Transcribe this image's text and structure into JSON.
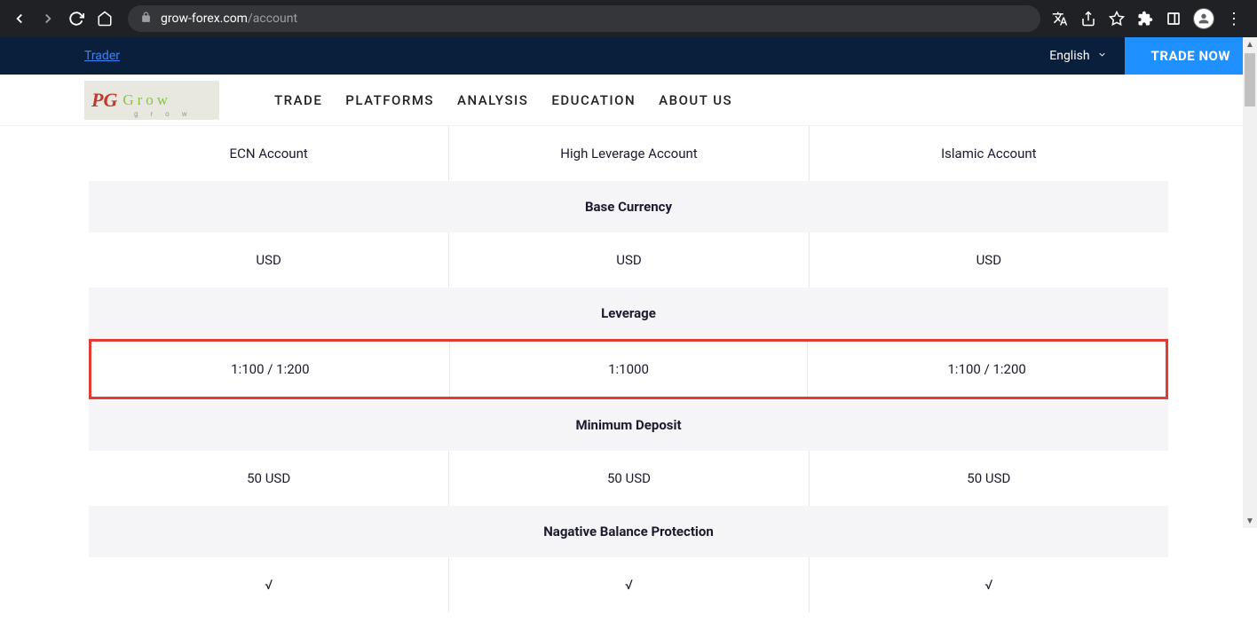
{
  "browser": {
    "url_host": "grow-forex.com",
    "url_path": "/account"
  },
  "topbar": {
    "trader": "Trader",
    "language": "English",
    "trade_now": "TRADE NOW"
  },
  "nav": {
    "items": [
      "TRADE",
      "PLATFORMS",
      "ANALYSIS",
      "EDUCATION",
      "ABOUT US"
    ]
  },
  "table": {
    "account_types": [
      "ECN Account",
      "High Leverage Account",
      "Islamic Account"
    ],
    "sections": {
      "base_currency": {
        "label": "Base Currency",
        "values": [
          "USD",
          "USD",
          "USD"
        ]
      },
      "leverage": {
        "label": "Leverage",
        "values": [
          "1:100 / 1:200",
          "1:1000",
          "1:100 / 1:200"
        ],
        "highlighted": true
      },
      "min_deposit": {
        "label": "Minimum Deposit",
        "values": [
          "50 USD",
          "50 USD",
          "50 USD"
        ]
      },
      "neg_balance": {
        "label": "Nagative Balance Protection",
        "values": [
          "√",
          "√",
          "√"
        ]
      }
    }
  }
}
